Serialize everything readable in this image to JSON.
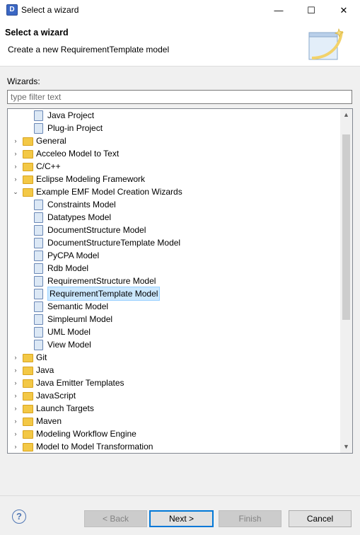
{
  "window": {
    "title": "Select a wizard",
    "minimize": "—",
    "maximize": "☐",
    "close": "✕"
  },
  "banner": {
    "heading": "Select a wizard",
    "description": "Create a new RequirementTemplate model"
  },
  "filter": {
    "label": "Wizards:",
    "placeholder": "type filter text",
    "value": ""
  },
  "tree": {
    "items": [
      {
        "label": "Java Project",
        "depth": 1,
        "expander": "",
        "icon": "java-project-icon"
      },
      {
        "label": "Plug-in Project",
        "depth": 1,
        "expander": "",
        "icon": "plugin-project-icon"
      },
      {
        "label": "General",
        "depth": 0,
        "expander": "›",
        "icon": "folder-icon"
      },
      {
        "label": "Acceleo Model to Text",
        "depth": 0,
        "expander": "›",
        "icon": "folder-icon"
      },
      {
        "label": "C/C++",
        "depth": 0,
        "expander": "›",
        "icon": "folder-icon"
      },
      {
        "label": "Eclipse Modeling Framework",
        "depth": 0,
        "expander": "›",
        "icon": "folder-icon"
      },
      {
        "label": "Example EMF Model Creation Wizards",
        "depth": 0,
        "expander": "⌄",
        "icon": "folder-open-icon"
      },
      {
        "label": "Constraints Model",
        "depth": 1,
        "expander": "",
        "icon": "model-icon"
      },
      {
        "label": "Datatypes Model",
        "depth": 1,
        "expander": "",
        "icon": "model-icon"
      },
      {
        "label": "DocumentStructure Model",
        "depth": 1,
        "expander": "",
        "icon": "document-icon"
      },
      {
        "label": "DocumentStructureTemplate Model",
        "depth": 1,
        "expander": "",
        "icon": "document-template-icon"
      },
      {
        "label": "PyCPA Model",
        "depth": 1,
        "expander": "",
        "icon": "model-icon"
      },
      {
        "label": "Rdb Model",
        "depth": 1,
        "expander": "",
        "icon": "model-icon"
      },
      {
        "label": "RequirementStructure Model",
        "depth": 1,
        "expander": "",
        "icon": "model-icon"
      },
      {
        "label": "RequirementTemplate Model",
        "depth": 1,
        "expander": "",
        "icon": "requirement-template-icon",
        "selected": true
      },
      {
        "label": "Semantic Model",
        "depth": 1,
        "expander": "",
        "icon": "model-icon"
      },
      {
        "label": "Simpleuml Model",
        "depth": 1,
        "expander": "",
        "icon": "model-icon"
      },
      {
        "label": "UML Model",
        "depth": 1,
        "expander": "",
        "icon": "uml-icon"
      },
      {
        "label": "View Model",
        "depth": 1,
        "expander": "",
        "icon": "model-icon"
      },
      {
        "label": "Git",
        "depth": 0,
        "expander": "›",
        "icon": "folder-icon"
      },
      {
        "label": "Java",
        "depth": 0,
        "expander": "›",
        "icon": "folder-icon"
      },
      {
        "label": "Java Emitter Templates",
        "depth": 0,
        "expander": "›",
        "icon": "folder-icon"
      },
      {
        "label": "JavaScript",
        "depth": 0,
        "expander": "›",
        "icon": "folder-icon"
      },
      {
        "label": "Launch Targets",
        "depth": 0,
        "expander": "›",
        "icon": "folder-icon"
      },
      {
        "label": "Maven",
        "depth": 0,
        "expander": "›",
        "icon": "folder-icon"
      },
      {
        "label": "Modeling Workflow Engine",
        "depth": 0,
        "expander": "›",
        "icon": "folder-icon"
      },
      {
        "label": "Model to Model Transformation",
        "depth": 0,
        "expander": "›",
        "icon": "folder-icon"
      }
    ]
  },
  "buttons": {
    "help": "?",
    "back": "< Back",
    "next": "Next >",
    "finish": "Finish",
    "cancel": "Cancel"
  }
}
